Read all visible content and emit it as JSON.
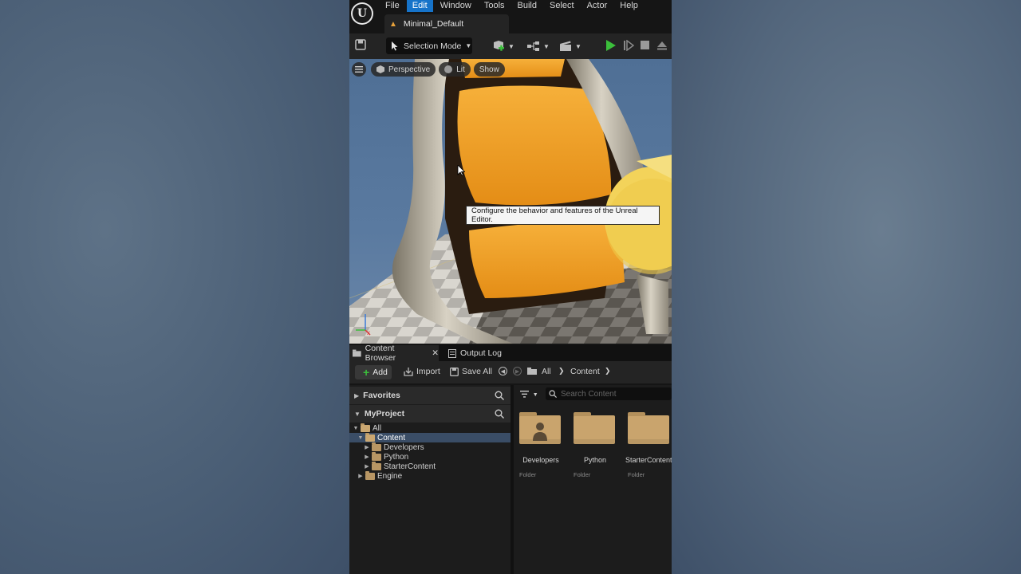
{
  "menu": {
    "items": [
      "File",
      "Edit",
      "Window",
      "Tools",
      "Build",
      "Select",
      "Actor",
      "Help"
    ],
    "active_index": 1
  },
  "project_tab": {
    "label": "Minimal_Default"
  },
  "toolbar": {
    "selection_mode": "Selection Mode",
    "icons": [
      "save-icon",
      "add-actor-icon",
      "blueprint-icon",
      "cinematics-icon",
      "play-icon",
      "advance-frame-icon",
      "stop-icon",
      "eject-icon"
    ]
  },
  "viewport": {
    "perspective": "Perspective",
    "lit": "Lit",
    "show": "Show",
    "tooltip": "Configure the behavior and features of the Unreal Editor."
  },
  "dock_tabs": {
    "content_browser": "Content Browser",
    "output_log": "Output Log"
  },
  "content_toolbar": {
    "add": "Add",
    "import": "Import",
    "save_all": "Save All",
    "breadcrumb": [
      "All",
      "Content"
    ]
  },
  "sources": {
    "favorites": "Favorites",
    "project": "MyProject",
    "tree": [
      {
        "label": "All",
        "level": 0,
        "expanded": true
      },
      {
        "label": "Content",
        "level": 1,
        "expanded": true,
        "selected": true
      },
      {
        "label": "Developers",
        "level": 2
      },
      {
        "label": "Python",
        "level": 2
      },
      {
        "label": "StarterContent",
        "level": 2
      },
      {
        "label": "Engine",
        "level": 1
      }
    ]
  },
  "assets": {
    "search_placeholder": "Search Content",
    "items": [
      {
        "name": "Developers",
        "type": "Folder"
      },
      {
        "name": "Python",
        "type": "Folder"
      },
      {
        "name": "StarterContent",
        "type": "Folder"
      }
    ]
  },
  "colors": {
    "accent": "#1673c9",
    "play_green": "#3bbf3b",
    "folder": "#c9a46d",
    "chair_orange": "#f0a430"
  }
}
